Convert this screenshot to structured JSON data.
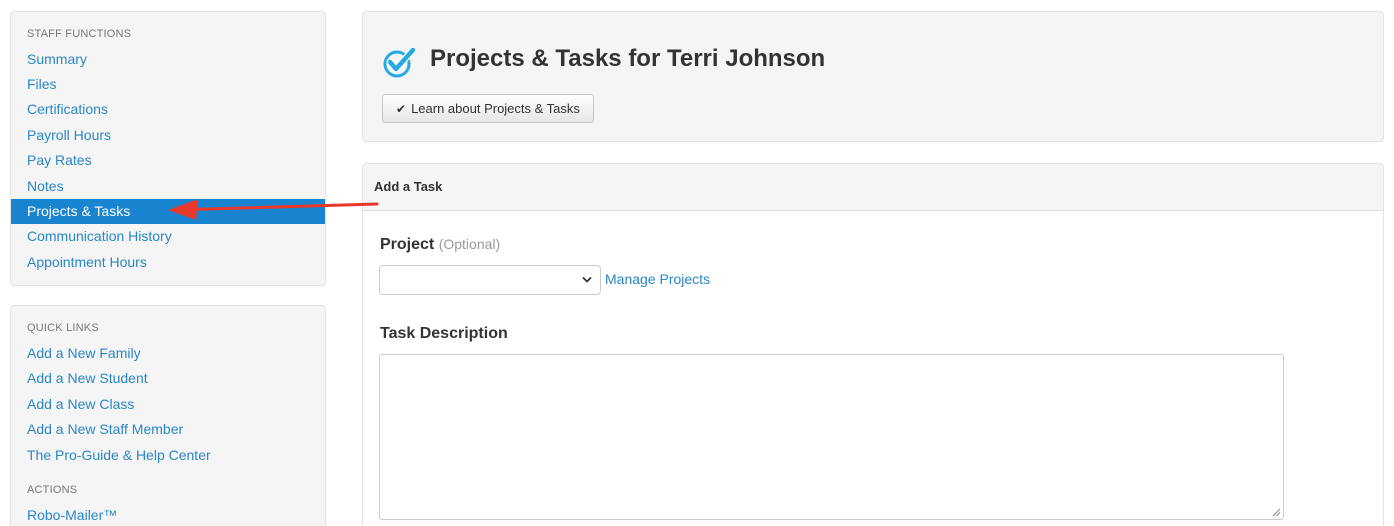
{
  "sidebar": {
    "staff_functions": {
      "heading": "STAFF FUNCTIONS",
      "items": [
        {
          "label": "Summary",
          "active": false
        },
        {
          "label": "Files",
          "active": false
        },
        {
          "label": "Certifications",
          "active": false
        },
        {
          "label": "Payroll Hours",
          "active": false
        },
        {
          "label": "Pay Rates",
          "active": false
        },
        {
          "label": "Notes",
          "active": false
        },
        {
          "label": "Projects & Tasks",
          "active": true
        },
        {
          "label": "Communication History",
          "active": false
        },
        {
          "label": "Appointment Hours",
          "active": false
        }
      ]
    },
    "quick_links": {
      "heading": "QUICK LINKS",
      "items": [
        {
          "label": "Add a New Family"
        },
        {
          "label": "Add a New Student"
        },
        {
          "label": "Add a New Class"
        },
        {
          "label": "Add a New Staff Member"
        },
        {
          "label": "The Pro-Guide & Help Center"
        }
      ]
    },
    "actions": {
      "heading": "ACTIONS",
      "items": [
        {
          "label": "Robo-Mailer™"
        }
      ]
    }
  },
  "header": {
    "icon": "blue-checkmark-icon",
    "title": "Projects & Tasks for Terri Johnson",
    "learn_button_label": "Learn about Projects & Tasks"
  },
  "add_task": {
    "panel_title": "Add a Task",
    "project_label": "Project",
    "project_optional": "(Optional)",
    "project_selected": "",
    "manage_projects_link": "Manage Projects",
    "description_label": "Task Description",
    "description_value": ""
  },
  "colors": {
    "link": "#2a86c5",
    "active_bg": "#1985d0",
    "panel_bg": "#f5f5f5",
    "annotation_arrow": "#e8392c",
    "check_icon": "#29a9e1"
  }
}
